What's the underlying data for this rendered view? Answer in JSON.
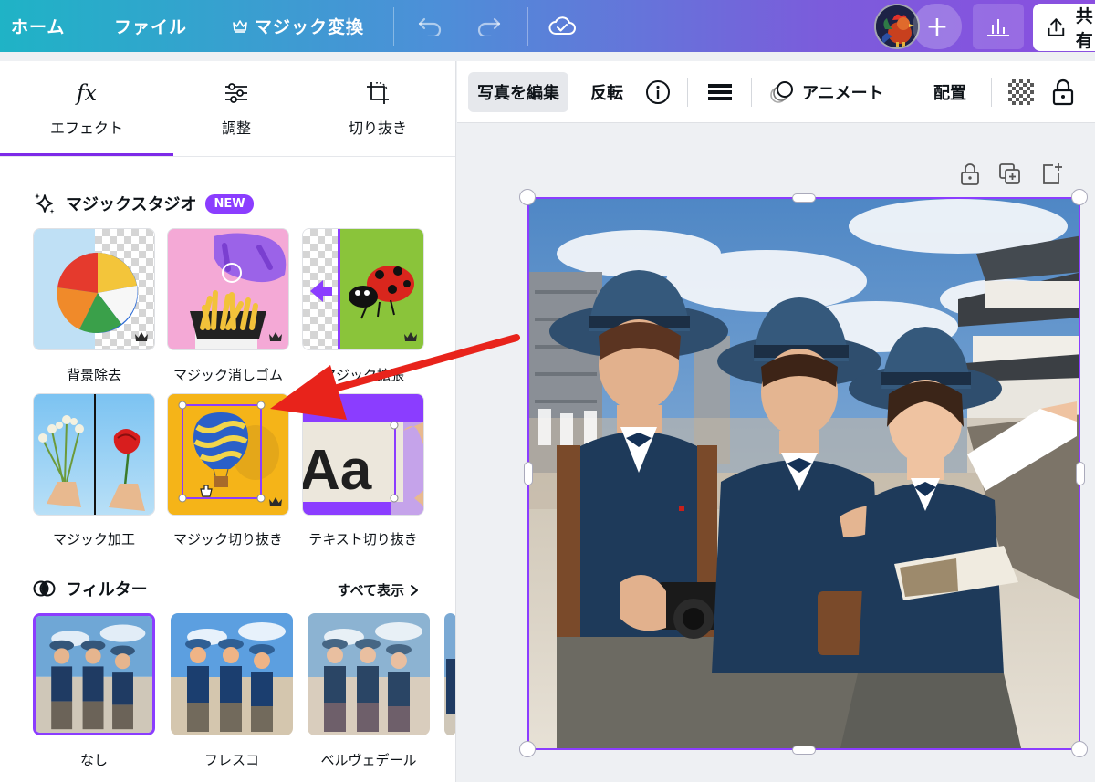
{
  "topbar": {
    "home_label": "ホーム",
    "file_label": "ファイル",
    "magic_switch_label": "マジック変換",
    "share_label": "共有"
  },
  "panel": {
    "tabs": [
      {
        "label": "エフェクト",
        "icon": "fx-icon",
        "active": true
      },
      {
        "label": "調整",
        "icon": "sliders-icon",
        "active": false
      },
      {
        "label": "切り抜き",
        "icon": "crop-icon",
        "active": false
      }
    ],
    "magic_studio": {
      "title": "マジックスタジオ",
      "badge": "NEW",
      "tools": [
        {
          "label": "背景除去"
        },
        {
          "label": "マジック消しゴム"
        },
        {
          "label": "マジック拡張"
        },
        {
          "label": "マジック加工"
        },
        {
          "label": "マジック切り抜き"
        },
        {
          "label": "テキスト切り抜き"
        }
      ]
    },
    "filters": {
      "title": "フィルター",
      "see_all": "すべて表示",
      "items": [
        {
          "label": "なし",
          "selected": true
        },
        {
          "label": "フレスコ",
          "selected": false
        },
        {
          "label": "ベルヴェデール",
          "selected": false
        }
      ]
    }
  },
  "toolbar": {
    "edit_photo": "写真を編集",
    "flip": "反転",
    "animate": "アニメート",
    "position": "配置"
  },
  "colors": {
    "accent": "#8b3dff",
    "arrow": "#e8231b",
    "topbar_start": "#1fb3c6",
    "topbar_end": "#8a4fe0"
  }
}
